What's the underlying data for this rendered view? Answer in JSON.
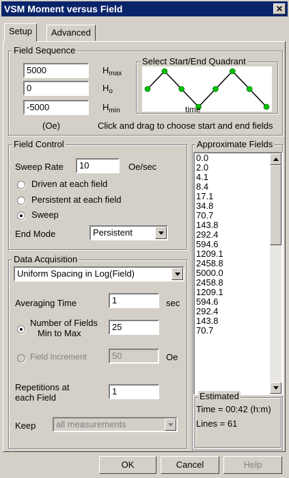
{
  "window": {
    "title": "VSM Moment versus Field",
    "close_glyph": "✕"
  },
  "tabs": [
    {
      "label": "Setup",
      "active": true
    },
    {
      "label": "Advanced",
      "active": false
    }
  ],
  "field_sequence": {
    "group_title": "Field Sequence",
    "hmax": {
      "value": "5000",
      "label": "H",
      "sub": "max"
    },
    "ho": {
      "value": "0",
      "label": "H",
      "sub": "o"
    },
    "hmin": {
      "value": "-5000",
      "label": "H",
      "sub": "min"
    },
    "unit": "(Oe)",
    "quadrant": {
      "title": "Select Start/End Quadrant",
      "axis_label": "time",
      "line_color": "#000000",
      "point_color": "#00c000",
      "points": [
        0.0,
        1.0,
        0.0,
        -1.0,
        0.0,
        1.0,
        0.0,
        -1.0
      ]
    },
    "hint": "Click and drag to choose start and end fields"
  },
  "field_control": {
    "group_title": "Field Control",
    "sweep_rate_label": "Sweep Rate",
    "sweep_rate_value": "10",
    "sweep_rate_unit": "Oe/sec",
    "options": [
      {
        "label": "Driven at each field",
        "selected": false
      },
      {
        "label": "Persistent at each field",
        "selected": false
      },
      {
        "label": "Sweep",
        "selected": true
      }
    ],
    "end_mode_label": "End Mode",
    "end_mode_value": "Persistent"
  },
  "approximate_fields": {
    "group_title": "Approximate Fields",
    "values": [
      "0.0",
      "2.0",
      "4.1",
      "8.4",
      "17.1",
      "34.8",
      "70.7",
      "143.8",
      "292.4",
      "594.6",
      "1209.1",
      "2458.8",
      "5000.0",
      "2458.8",
      "1209.1",
      "594.6",
      "292.4",
      "143.8",
      "70.7"
    ]
  },
  "data_acquisition": {
    "group_title": "Data Acquisition",
    "spacing_value": "Uniform Spacing in Log(Field)",
    "averaging_time_label": "Averaging Time",
    "averaging_time_value": "1",
    "averaging_time_unit": "sec",
    "num_fields_label_1": "Number of Fields",
    "num_fields_label_2": "Min to Max",
    "num_fields_value": "25",
    "num_fields_selected": true,
    "field_increment_label": "Field Increment",
    "field_increment_value": "50",
    "field_increment_unit": "Oe",
    "repetitions_label_1": "Repetitions at",
    "repetitions_label_2": "each Field",
    "repetitions_value": "1",
    "keep_label": "Keep",
    "keep_value": "all measurements"
  },
  "estimated": {
    "group_title": "Estimated",
    "time": "Time = 00:42 (h:m)",
    "lines": "Lines = 61"
  },
  "buttons": {
    "ok": "OK",
    "cancel": "Cancel",
    "help": "Help"
  }
}
